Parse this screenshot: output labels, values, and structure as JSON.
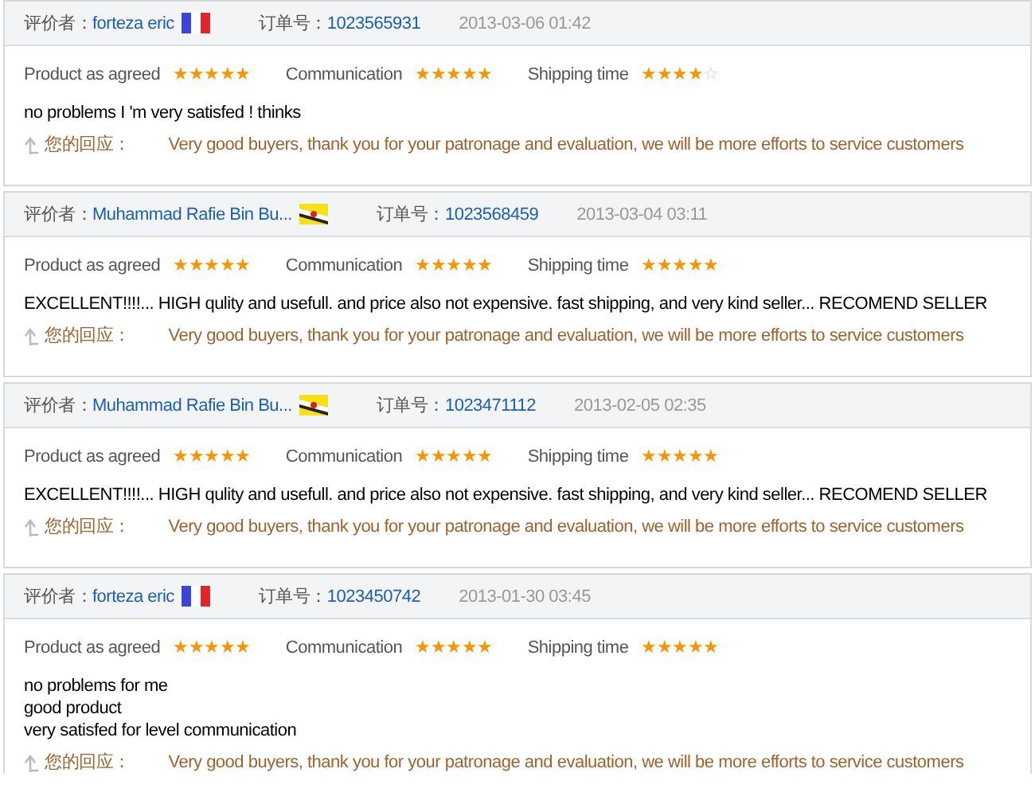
{
  "reviews": [
    {
      "reviewer_label": "评价者：",
      "reviewer": "forteza eric",
      "kind": "fr",
      "order_label": "订单号：",
      "order": "1023565931",
      "date": "2013-03-06 01:42",
      "ratings": [
        {
          "label": "Product as agreed",
          "stars": 5
        },
        {
          "label": "Communication",
          "stars": 5
        },
        {
          "label": "Shipping time",
          "stars": 4
        }
      ],
      "comment": [
        "no problems I 'm very satisfed ! thinks"
      ],
      "reply_label": "您的回应：",
      "reply": "Very good buyers, thank you for your patronage and evaluation, we will be more efforts to service customers"
    },
    {
      "reviewer_label": "评价者：",
      "reviewer": "Muhammad Rafie Bin Bu...",
      "kind": "bn",
      "order_label": "订单号：",
      "order": "1023568459",
      "date": "2013-03-04 03:11",
      "ratings": [
        {
          "label": "Product as agreed",
          "stars": 5
        },
        {
          "label": "Communication",
          "stars": 5
        },
        {
          "label": "Shipping time",
          "stars": 5
        }
      ],
      "comment": [
        "EXCELLENT!!!!... HIGH qulity and usefull. and price also not expensive. fast shipping, and very kind seller... RECOMEND SELLER"
      ],
      "reply_label": "您的回应：",
      "reply": "Very good buyers, thank you for your patronage and evaluation, we will be more efforts to service customers"
    },
    {
      "reviewer_label": "评价者：",
      "reviewer": "Muhammad Rafie Bin Bu...",
      "kind": "bn",
      "order_label": "订单号：",
      "order": "1023471112",
      "date": "2013-02-05 02:35",
      "ratings": [
        {
          "label": "Product as agreed",
          "stars": 5
        },
        {
          "label": "Communication",
          "stars": 5
        },
        {
          "label": "Shipping time",
          "stars": 5
        }
      ],
      "comment": [
        "EXCELLENT!!!!... HIGH qulity and usefull. and price also not expensive. fast shipping, and very kind seller... RECOMEND SELLER"
      ],
      "reply_label": "您的回应：",
      "reply": "Very good buyers, thank you for your patronage and evaluation, we will be more efforts to service customers"
    },
    {
      "reviewer_label": "评价者：",
      "reviewer": "forteza eric",
      "kind": "fr",
      "order_label": "订单号：",
      "order": "1023450742",
      "date": "2013-01-30 03:45",
      "ratings": [
        {
          "label": "Product as agreed",
          "stars": 5
        },
        {
          "label": "Communication",
          "stars": 5
        },
        {
          "label": "Shipping time",
          "stars": 5
        }
      ],
      "comment": [
        "no problems for me",
        "good product",
        "very satisfed for level communication"
      ],
      "reply_label": "您的回应：",
      "reply": "Very good buyers, thank you for your patronage and evaluation, we will be more efforts to service customers"
    }
  ]
}
